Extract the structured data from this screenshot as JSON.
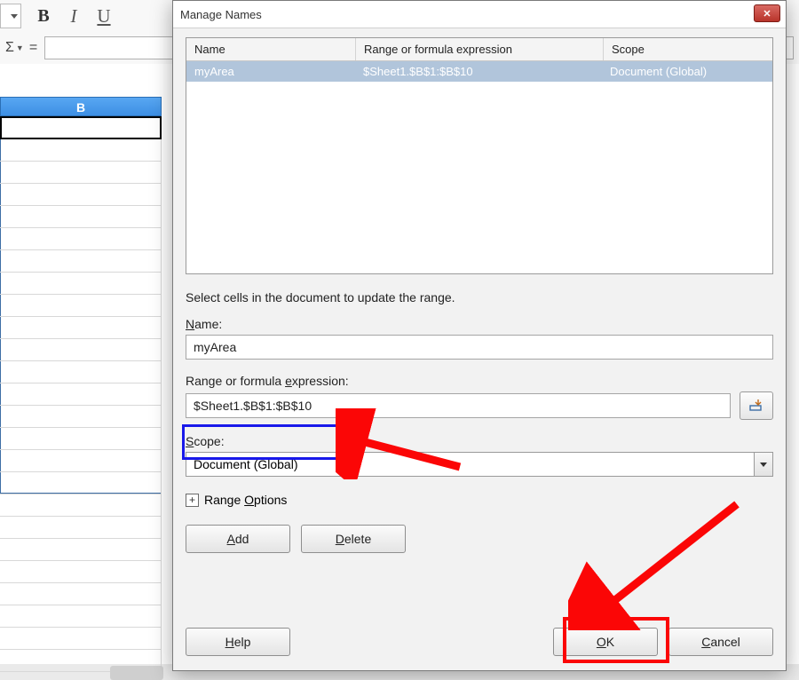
{
  "toolbar": {
    "bold": "B",
    "italic": "I",
    "underline": "U",
    "sigma": "Σ",
    "equals": "="
  },
  "sheet": {
    "column_label": "B"
  },
  "dialog": {
    "title": "Manage Names",
    "columns": {
      "name": "Name",
      "range": "Range or formula expression",
      "scope": "Scope"
    },
    "rows": [
      {
        "name": "myArea",
        "range": "$Sheet1.$B$1:$B$10",
        "scope": "Document (Global)"
      }
    ],
    "hint": "Select cells in the document to update the range.",
    "name_label_pre": "",
    "name_label_u": "N",
    "name_label_post": "ame:",
    "name_value": "myArea",
    "range_label_pre": "Range or formula ",
    "range_label_u": "e",
    "range_label_post": "xpression:",
    "range_value": "$Sheet1.$B$1:$B$10",
    "scope_label_pre": "",
    "scope_label_u": "S",
    "scope_label_post": "cope:",
    "scope_value": "Document (Global)",
    "expander_pre": "Range ",
    "expander_u": "O",
    "expander_post": "ptions",
    "buttons": {
      "add_u": "A",
      "add_post": "dd",
      "delete_u": "D",
      "delete_post": "elete",
      "help_u": "H",
      "help_post": "elp",
      "ok_u": "O",
      "ok_post": "K",
      "cancel_u": "C",
      "cancel_post": "ancel"
    }
  }
}
